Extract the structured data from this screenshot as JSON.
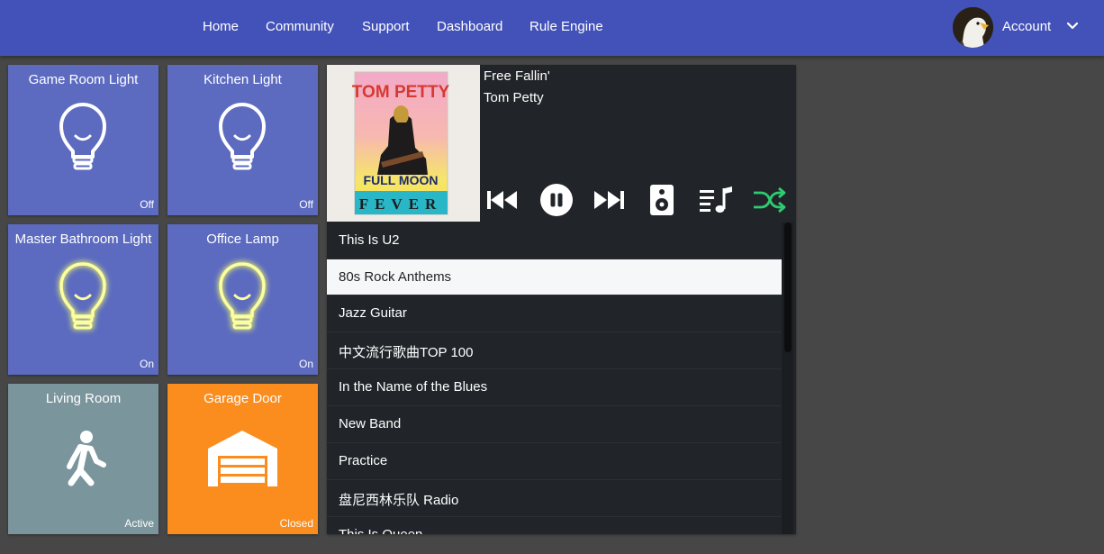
{
  "nav": {
    "links": [
      "Home",
      "Community",
      "Support",
      "Dashboard",
      "Rule Engine"
    ],
    "account_label": "Account"
  },
  "tiles": [
    {
      "title": "Game Room Light",
      "status": "Off",
      "icon": "lightbulb-icon"
    },
    {
      "title": "Kitchen Light",
      "status": "Off",
      "icon": "lightbulb-icon"
    },
    {
      "title": "Master Bathroom Light",
      "status": "On",
      "icon": "lightbulb-glowing-icon"
    },
    {
      "title": "Office Lamp",
      "status": "On",
      "icon": "lightbulb-glowing-icon"
    },
    {
      "title": "Living Room",
      "status": "Active",
      "icon": "walking-person-icon"
    },
    {
      "title": "Garage Door",
      "status": "Closed",
      "icon": "garage-icon"
    }
  ],
  "player": {
    "track_title": "Free Fallin'",
    "artist": "Tom Petty",
    "album_art": {
      "top_text": "TOM PETTY",
      "middle_text": "FULL MOON",
      "bottom_text": "FEVER"
    },
    "controls": [
      "previous-icon",
      "pause-icon",
      "next-icon",
      "speaker-icon",
      "queue-icon",
      "shuffle-icon"
    ],
    "shuffle_color": "#2ecc71",
    "playlists": [
      "This Is U2",
      "80s Rock Anthems",
      "Jazz Guitar",
      "中文流行歌曲TOP 100",
      "In the Name of the Blues",
      "New Band",
      "Practice",
      "盘尼西林乐队 Radio",
      "This Is Queen"
    ],
    "selected_playlist": "80s Rock Anthems"
  },
  "colors": {
    "navbar": "#4352b8",
    "tile_blue": "#5c6bc0",
    "tile_grey": "#7b959d",
    "tile_orange": "#fb8c1e",
    "bulb_glow": "#f1f76a",
    "player_bg": "#212529"
  }
}
